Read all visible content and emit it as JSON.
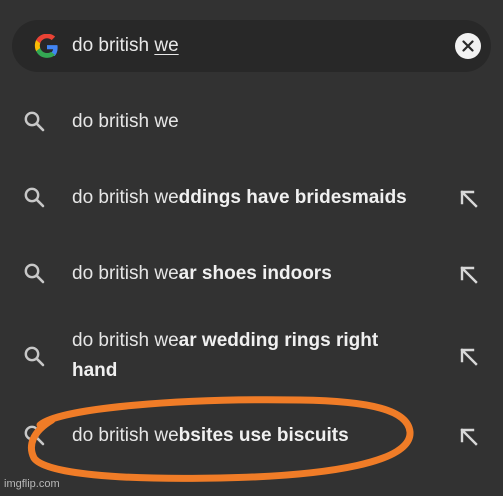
{
  "search": {
    "query_prefix": "do british ",
    "query_typed": "we",
    "logo_icon": "google-g-icon",
    "clear_icon": "close-icon"
  },
  "suggestions": [
    {
      "prefix": "do british we",
      "completion": "",
      "icon": "search-icon",
      "has_arrow": false
    },
    {
      "prefix": "do british we",
      "completion": "ddings have bridesmaids",
      "icon": "search-icon",
      "has_arrow": true
    },
    {
      "prefix": "do british we",
      "completion": "ar shoes indoors",
      "icon": "search-icon",
      "has_arrow": true
    },
    {
      "prefix": "do british we",
      "completion": "ar wedding rings right hand",
      "icon": "search-icon",
      "has_arrow": true
    },
    {
      "prefix": "do british we",
      "completion": "bsites use biscuits",
      "icon": "search-icon",
      "has_arrow": true
    }
  ],
  "annotation": {
    "color": "#f07c27",
    "target": "suggestion 5"
  },
  "watermark": "imgflip.com",
  "colors": {
    "background": "#323232",
    "search_bar": "#282828",
    "text": "#e6e6e6",
    "icon": "#c8c8c8"
  }
}
